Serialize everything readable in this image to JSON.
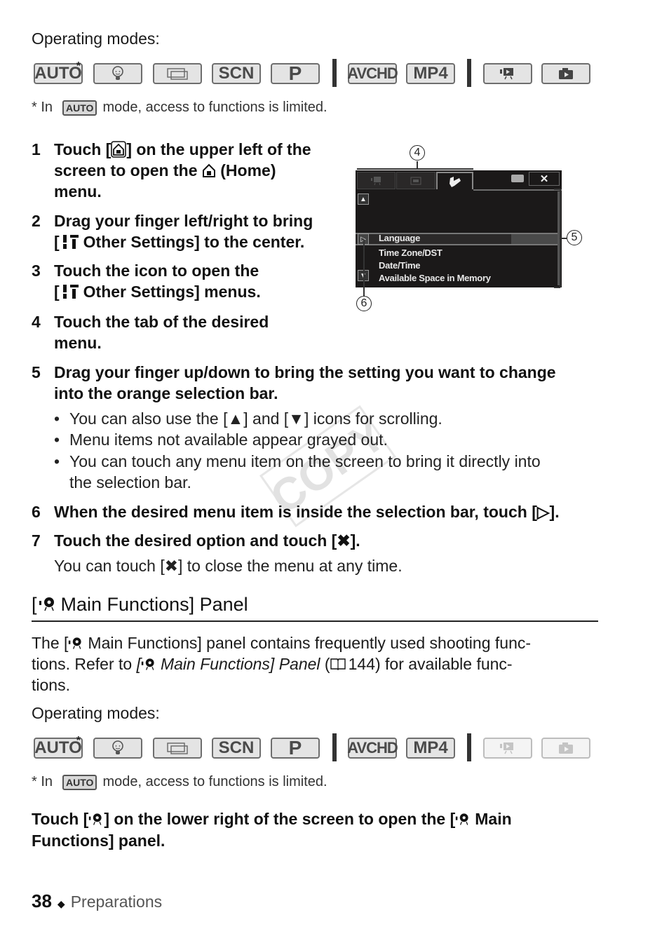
{
  "page": {
    "number": "38",
    "section": "Preparations",
    "watermark": "COPY"
  },
  "modes_top": {
    "label": "Operating modes:",
    "items": [
      {
        "name": "AUTO",
        "active": true,
        "star": "*"
      },
      {
        "name": "baby-icon",
        "active": true
      },
      {
        "name": "cinema-icon",
        "active": true
      },
      {
        "name": "SCN",
        "active": true
      },
      {
        "name": "P",
        "active": true
      },
      {
        "name": "AVCHD",
        "active": true
      },
      {
        "name": "MP4",
        "active": true
      },
      {
        "name": "playback-movie-icon",
        "active": true
      },
      {
        "name": "playback-photo-icon",
        "active": true
      }
    ],
    "footnote_prefix": "*  In",
    "footnote_chip": "AUTO",
    "footnote_suffix": "mode, access to functions is limited."
  },
  "steps": [
    {
      "num": "1",
      "lines": [
        "Touch [",
        "] on the upper left of the",
        "screen to open the",
        "(Home)",
        "menu."
      ]
    },
    {
      "num": "2",
      "lines": [
        "Drag your finger left/right to bring",
        "[",
        "Other Settings] to the center."
      ]
    },
    {
      "num": "3",
      "lines": [
        "Touch the icon to open the",
        "[",
        "Other Settings] menus."
      ]
    },
    {
      "num": "4",
      "lines": [
        "Touch the tab of the desired",
        "menu."
      ]
    },
    {
      "num": "5",
      "lines": [
        "Drag your finger up/down to bring the setting you want to change",
        "into the orange selection bar."
      ]
    },
    {
      "num": "6",
      "text": "When the desired menu item is inside the selection bar, touch [▷]."
    },
    {
      "num": "7",
      "text": "Touch the desired option and touch [✖]."
    }
  ],
  "step5_bullets": [
    "You can also use the [▲] and [▼] icons for scrolling.",
    "Menu items not available appear grayed out.",
    "You can touch any menu item on the screen to bring it directly into",
    "the selection bar."
  ],
  "step7_note": "You can touch [✖] to close the menu at any time.",
  "camera_screen": {
    "close_label": "✕",
    "items": [
      "Language",
      "Time Zone/DST",
      "Date/Time",
      "Available Space in Memory"
    ],
    "callouts": [
      "④",
      "⑤",
      "⑥"
    ],
    "callout_numbers": [
      "4",
      "5",
      "6"
    ]
  },
  "section": {
    "title": "Main Functions] Panel",
    "title_prefix": "[",
    "para_line1_a": "The [",
    "para_line1_b": "Main Functions] panel contains frequently used shooting func-",
    "para_line2_a": "tions. Refer to ",
    "para_line2_italic_a": "[",
    "para_line2_italic_b": "Main Functions] Panel",
    "para_line2_b": " (",
    "para_line2_page": "144) for available func-",
    "para_line3": "tions."
  },
  "modes_bottom": {
    "label": "Operating modes:",
    "items": [
      {
        "name": "AUTO",
        "active": true,
        "star": "*"
      },
      {
        "name": "baby-icon",
        "active": true
      },
      {
        "name": "cinema-icon",
        "active": true
      },
      {
        "name": "SCN",
        "active": true
      },
      {
        "name": "P",
        "active": true
      },
      {
        "name": "AVCHD",
        "active": true
      },
      {
        "name": "MP4",
        "active": true
      },
      {
        "name": "playback-movie-icon",
        "active": false
      },
      {
        "name": "playback-photo-icon",
        "active": false
      }
    ],
    "footnote_prefix": "*  In",
    "footnote_chip": "AUTO",
    "footnote_suffix": "mode, access to functions is limited."
  },
  "final": {
    "line1_a": "Touch [",
    "line1_b": "] on the lower right of the screen to open the [",
    "line1_c": "Main",
    "line2": "Functions] panel."
  },
  "labels": {
    "auto": "AUTO",
    "scn": "SCN",
    "p": "P",
    "avchd": "AVCHD",
    "mp4": "MP4"
  }
}
